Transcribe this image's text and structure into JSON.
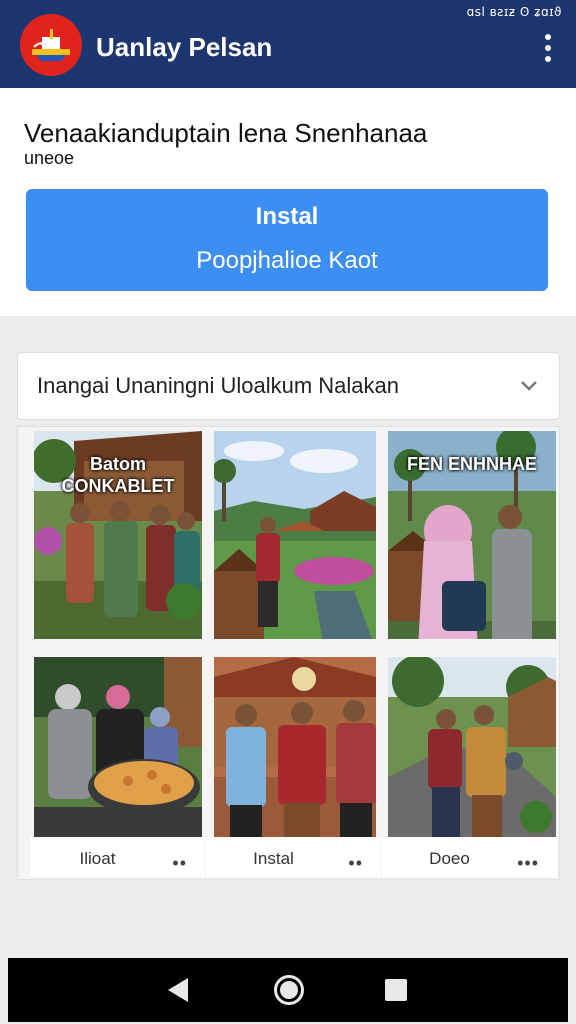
{
  "statusbar": {
    "text": "ɑsl ʙƨɪƶ ʘ ʑɑɪϑ"
  },
  "app": {
    "title": "Uanlay Pelsan"
  },
  "header": {
    "headline": "Venaakianduptain lena Snenhanaa",
    "subline": "uneoe"
  },
  "install_button": {
    "label_primary": "Instal",
    "label_secondary": "Poopjhalioe Kaot"
  },
  "dropdown": {
    "selected": "Inangai Unaningni Uloalkum Nalakan"
  },
  "gallery": {
    "tiles": [
      {
        "overlay": "Batom CONKABLET",
        "scene": "group-of-four-with-house"
      },
      {
        "overlay": "",
        "scene": "man-in-garden-with-houses"
      },
      {
        "overlay": "FEN ENHNHAE",
        "scene": "woman-in-hijab-and-man"
      },
      {
        "overlay": "",
        "scene": "group-with-food-pan"
      },
      {
        "overlay": "",
        "scene": "three-men-at-village"
      },
      {
        "overlay": "",
        "scene": "two-men-on-path"
      }
    ],
    "footers": [
      {
        "label": "Ilioat",
        "more": "••"
      },
      {
        "label": "Instal",
        "more": "••"
      },
      {
        "label": "Doeo",
        "more": "•••"
      }
    ]
  },
  "colors": {
    "appbar": "#1d3670",
    "accent": "#3d8ef3",
    "logo": "#e2231c"
  }
}
